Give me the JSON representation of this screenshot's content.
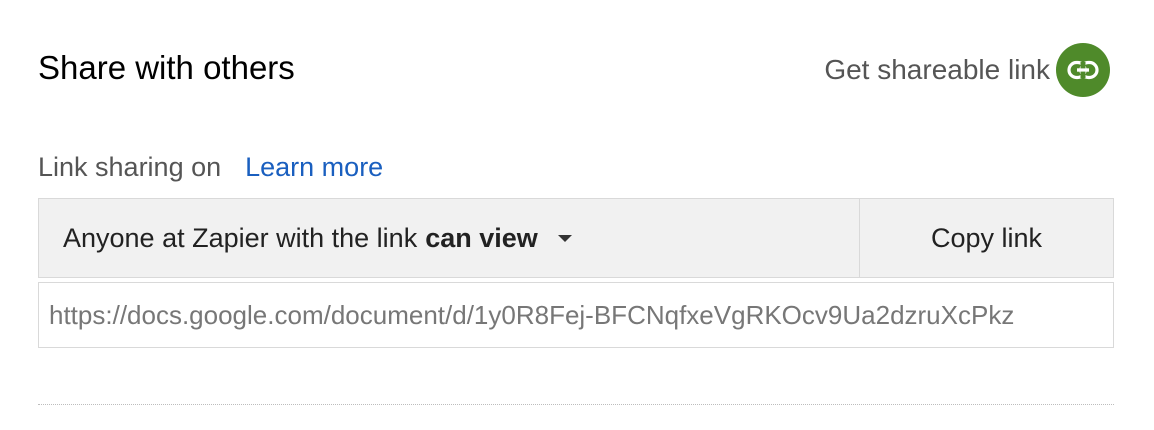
{
  "header": {
    "title": "Share with others",
    "shareable_link_label": "Get shareable link",
    "shareable_link_icon": "link-icon",
    "accent_color": "#4f8a2a"
  },
  "link_sharing": {
    "status": "Link sharing on",
    "learn_more": "Learn more",
    "access_prefix": "Anyone at Zapier with the link",
    "access_level": "can view",
    "copy_label": "Copy link",
    "url": "https://docs.google.com/document/d/1y0R8Fej-BFCNqfxeVgRKOcv9Ua2dzruXcPkz"
  }
}
